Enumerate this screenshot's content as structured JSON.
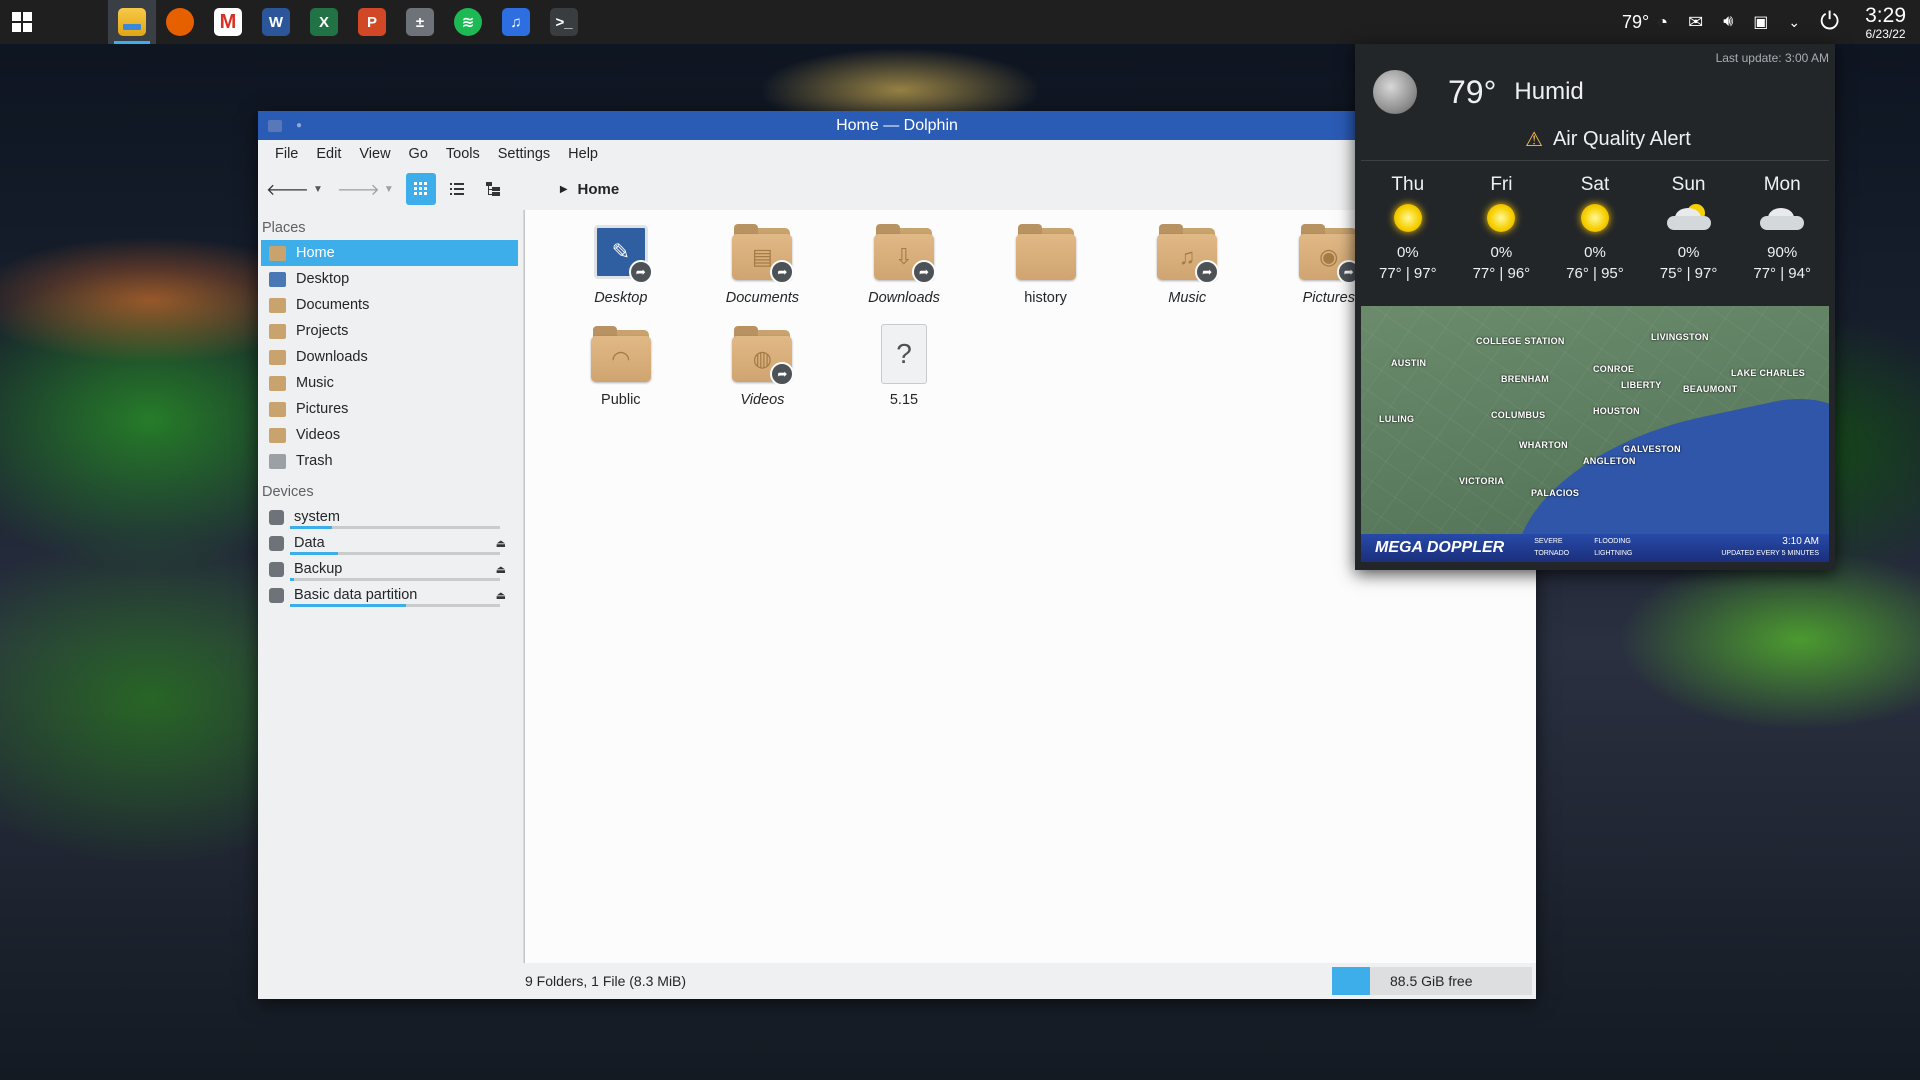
{
  "taskbar": {
    "apps": [
      {
        "name": "file-manager",
        "glyph": "",
        "color": "#f2b705"
      },
      {
        "name": "firefox",
        "glyph": "",
        "color": "#e66000"
      },
      {
        "name": "gmail",
        "glyph": "M",
        "color": "#ffffff"
      },
      {
        "name": "word",
        "glyph": "W",
        "color": "#2b579a"
      },
      {
        "name": "excel",
        "glyph": "X",
        "color": "#217346"
      },
      {
        "name": "powerpoint",
        "glyph": "P",
        "color": "#d24726"
      },
      {
        "name": "calculator",
        "glyph": "±",
        "color": "#6d7378"
      },
      {
        "name": "spotify",
        "glyph": "≋",
        "color": "#1db954"
      },
      {
        "name": "music",
        "glyph": "♫",
        "color": "#2d6fe0"
      },
      {
        "name": "terminal",
        "glyph": ">_",
        "color": "#3a3d40"
      }
    ],
    "weather_temp": "79°",
    "clock_time": "3:29",
    "clock_date": "6/23/22"
  },
  "window": {
    "title": "Home — Dolphin",
    "menu": [
      "File",
      "Edit",
      "View",
      "Go",
      "Tools",
      "Settings",
      "Help"
    ],
    "breadcrumb": "Home",
    "places_title": "Places",
    "places": [
      "Home",
      "Desktop",
      "Documents",
      "Projects",
      "Downloads",
      "Music",
      "Pictures",
      "Videos",
      "Trash"
    ],
    "devices_title": "Devices",
    "devices": [
      {
        "label": "system",
        "usage": 0.2,
        "eject": false
      },
      {
        "label": "Data",
        "usage": 0.23,
        "eject": true
      },
      {
        "label": "Backup",
        "usage": 0.02,
        "eject": true
      },
      {
        "label": "Basic data partition",
        "usage": 0.55,
        "eject": true
      }
    ],
    "files": [
      {
        "label": "Desktop",
        "italic": true,
        "glyph": "✎",
        "link": true
      },
      {
        "label": "Documents",
        "italic": true,
        "glyph": "▤",
        "link": true
      },
      {
        "label": "Downloads",
        "italic": true,
        "glyph": "⇩",
        "link": true
      },
      {
        "label": "history",
        "italic": false,
        "glyph": "",
        "link": false
      },
      {
        "label": "Music",
        "italic": true,
        "glyph": "♫",
        "link": true
      },
      {
        "label": "Pictures",
        "italic": true,
        "glyph": "◉",
        "link": true
      },
      {
        "label": "Public",
        "italic": false,
        "glyph": "◠",
        "link": false
      },
      {
        "label": "Videos",
        "italic": true,
        "glyph": "◍",
        "link": true
      },
      {
        "label": "5.15",
        "italic": false,
        "glyph": "?",
        "link": false
      }
    ],
    "status": "9 Folders, 1 File (8.3 MiB)",
    "free_space": "88.5 GiB free"
  },
  "weather": {
    "last_update": "Last update: 3:00 AM",
    "temp": "79°",
    "desc": "Humid",
    "alert": "Air Quality Alert",
    "forecast": [
      {
        "day": "Thu",
        "icon": "sun",
        "precip": "0%",
        "hilo": "77° | 97°"
      },
      {
        "day": "Fri",
        "icon": "sun",
        "precip": "0%",
        "hilo": "77° | 96°"
      },
      {
        "day": "Sat",
        "icon": "sun",
        "precip": "0%",
        "hilo": "76° | 95°"
      },
      {
        "day": "Sun",
        "icon": "cloud",
        "precip": "0%",
        "hilo": "75° | 97°"
      },
      {
        "day": "Mon",
        "icon": "cloud",
        "precip": "90%",
        "hilo": "77° | 94°"
      }
    ],
    "radar": {
      "labels": [
        "COLLEGE STATION",
        "LIVINGSTON",
        "AUSTIN",
        "BRENHAM",
        "CONROE",
        "LAKE CHARLES",
        "LIBERTY",
        "BEAUMONT",
        "LULING",
        "COLUMBUS",
        "HOUSTON",
        "WHARTON",
        "GALVESTON",
        "ANGLETON",
        "VICTORIA",
        "PALACIOS"
      ],
      "logo": "MEGA DOPPLER",
      "legend": [
        "SEVERE",
        "FLOODING",
        "TORNADO",
        "LIGHTNING"
      ],
      "time": "3:10 AM",
      "updated": "UPDATED EVERY 5 MINUTES"
    }
  }
}
